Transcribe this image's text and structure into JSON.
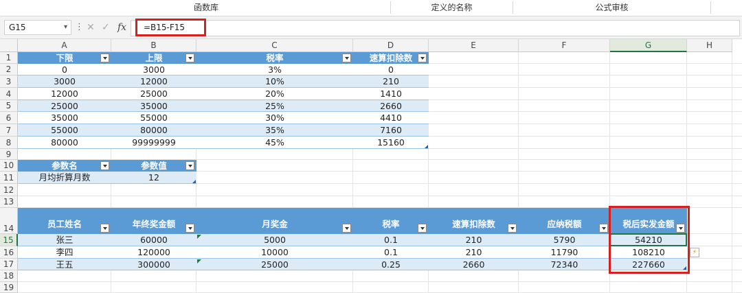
{
  "ribbon": {
    "groups": [
      "函数库",
      "定义的名称",
      "公式审核"
    ]
  },
  "formula_bar": {
    "name_box": "G15",
    "chevron_icon": "chevron-down-icon",
    "more_icon": "⋮",
    "cancel_icon": "✕",
    "enter_icon": "✓",
    "fx_label": "fx",
    "formula": "=B15-F15"
  },
  "columns": [
    "A",
    "B",
    "C",
    "D",
    "E",
    "F",
    "G",
    "H"
  ],
  "rows": [
    "1",
    "2",
    "3",
    "4",
    "5",
    "6",
    "7",
    "8",
    "9",
    "10",
    "11",
    "12",
    "13",
    "14",
    "15",
    "16",
    "17",
    "18",
    "19"
  ],
  "selected": {
    "column": "G",
    "row": "15"
  },
  "tax_table": {
    "headers": [
      "下限",
      "上限",
      "税率",
      "速算扣除数"
    ],
    "rows": [
      [
        "0",
        "3000",
        "3%",
        "0"
      ],
      [
        "3000",
        "12000",
        "10%",
        "210"
      ],
      [
        "12000",
        "25000",
        "20%",
        "1410"
      ],
      [
        "25000",
        "35000",
        "25%",
        "2660"
      ],
      [
        "35000",
        "55000",
        "30%",
        "4410"
      ],
      [
        "55000",
        "80000",
        "35%",
        "7160"
      ],
      [
        "80000",
        "99999999",
        "45%",
        "15160"
      ]
    ]
  },
  "param_table": {
    "headers": [
      "参数名",
      "参数值"
    ],
    "rows": [
      [
        "月均折算月数",
        "12"
      ]
    ]
  },
  "bonus_table": {
    "headers": [
      "员工姓名",
      "年终奖金额",
      "月奖金",
      "税率",
      "速算扣除数",
      "应纳税额",
      "税后实发金额"
    ],
    "rows": [
      [
        "张三",
        "60000",
        "5000",
        "0.1",
        "210",
        "5790",
        "54210"
      ],
      [
        "李四",
        "120000",
        "10000",
        "0.1",
        "210",
        "11790",
        "108210"
      ],
      [
        "王五",
        "300000",
        "25000",
        "0.25",
        "2660",
        "72340",
        "227660"
      ]
    ]
  },
  "quick_analysis_icon": "lightning-icon"
}
